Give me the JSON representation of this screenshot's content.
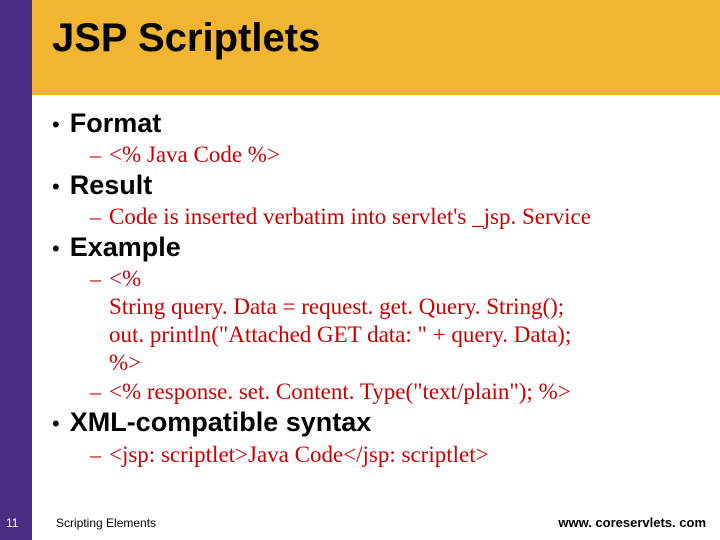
{
  "title": "JSP Scriptlets",
  "bullets": [
    {
      "label": "Format",
      "subs": [
        "<% Java Code %>"
      ]
    },
    {
      "label": "Result",
      "subs": [
        "Code is inserted verbatim into servlet's _jsp. Service"
      ]
    },
    {
      "label": "Example",
      "subs": [
        "<%\nString query. Data = request. get. Query. String();\nout. println(\"Attached GET data: \" + query. Data);\n%>",
        "<% response. set. Content. Type(\"text/plain\"); %>"
      ]
    },
    {
      "label": "XML-compatible syntax",
      "subs": [
        "<jsp: scriptlet>Java Code</jsp: scriptlet>"
      ]
    }
  ],
  "footer": {
    "page": "11",
    "left": "Scripting Elements",
    "right": "www. coreservlets. com"
  }
}
